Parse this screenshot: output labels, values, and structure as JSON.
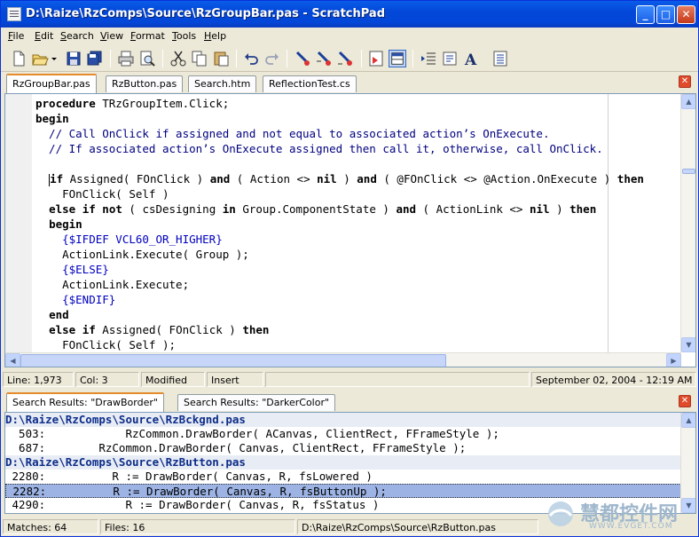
{
  "window": {
    "title": "D:\\Raize\\RzComps\\Source\\RzGroupBar.pas - ScratchPad",
    "controls": [
      "_",
      "□",
      "✕"
    ]
  },
  "menu": [
    "File",
    "Edit",
    "Search",
    "View",
    "Format",
    "Tools",
    "Help"
  ],
  "toolbar_icons": [
    "new-file-icon",
    "open-folder-icon",
    "save-icon",
    "save-all-icon",
    "print-icon",
    "print-preview-icon",
    "cut-icon",
    "copy-icon",
    "paste-icon",
    "undo-icon",
    "redo-icon",
    "bookmark-icon",
    "bookmark-next-icon",
    "bookmark-clear-icon",
    "toggle-results-icon",
    "split-view-icon",
    "indent-icon",
    "unindent-icon",
    "font-icon",
    "options-icon"
  ],
  "tabs": [
    {
      "label": "RzGroupBar.pas",
      "active": true
    },
    {
      "label": "RzButton.pas",
      "active": false
    },
    {
      "label": "Search.htm",
      "active": false
    },
    {
      "label": "ReflectionTest.cs",
      "active": false
    }
  ],
  "code_lines": [
    "procedure TRzGroupItem.Click;",
    "begin",
    "  // Call OnClick if assigned and not equal to associated action’s OnExecute.",
    "  // If associated action’s OnExecute assigned then call it, otherwise, call OnClick.",
    "",
    "  if Assigned( FOnClick ) and ( Action <> nil ) and ( @FOnClick <> @Action.OnExecute ) then",
    "    FOnClick( Self )",
    "  else if not ( csDesigning in Group.ComponentState ) and ( ActionLink <> nil ) then",
    "  begin",
    "    {$IFDEF VCL60_OR_HIGHER}",
    "    ActionLink.Execute( Group );",
    "    {$ELSE}",
    "    ActionLink.Execute;",
    "    {$ENDIF}",
    "  end",
    "  else if Assigned( FOnClick ) then",
    "    FOnClick( Self );"
  ],
  "status": {
    "line": "Line: 1,973",
    "col": "Col: 3",
    "modified": "Modified",
    "mode": "Insert",
    "datetime": "September 02, 2004 - 12:19 AM"
  },
  "result_tabs": [
    {
      "label": "Search Results: \"DrawBorder\"",
      "active": true
    },
    {
      "label": "Search Results: \"DarkerColor\"",
      "active": false
    }
  ],
  "results": [
    {
      "kind": "file",
      "text": "D:\\Raize\\RzComps\\Source\\RzBckgnd.pas"
    },
    {
      "kind": "match",
      "text": "  503:            RzCommon.DrawBorder( ACanvas, ClientRect, FFrameStyle );"
    },
    {
      "kind": "match",
      "text": "  687:        RzCommon.DrawBorder( Canvas, ClientRect, FFrameStyle );"
    },
    {
      "kind": "file",
      "text": "D:\\Raize\\RzComps\\Source\\RzButton.pas"
    },
    {
      "kind": "match",
      "text": " 2280:          R := DrawBorder( Canvas, R, fsLowered )"
    },
    {
      "kind": "selected",
      "text": " 2282:          R := DrawBorder( Canvas, R, fsButtonUp );"
    },
    {
      "kind": "match",
      "text": " 4290:            R := DrawBorder( Canvas, R, fsStatus )"
    }
  ],
  "bottom_status": {
    "matches": "Matches: 64",
    "files": "Files: 16",
    "path": "D:\\Raize\\RzComps\\Source\\RzButton.pas"
  },
  "watermark": {
    "title": "慧都控件网",
    "url": "WWW.EVGET.COM"
  }
}
